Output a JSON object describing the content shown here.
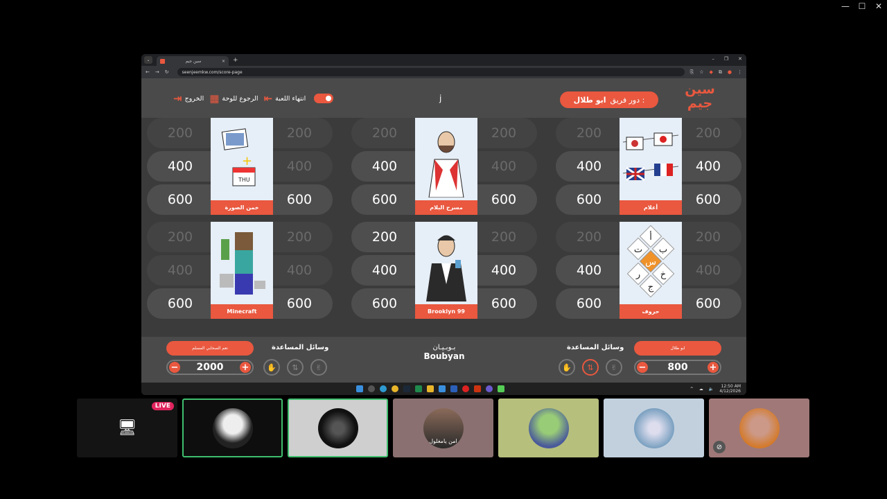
{
  "window_controls": {
    "minimize": "—",
    "maximize": "☐",
    "close": "✕"
  },
  "browser": {
    "tab_title": "سين جيم",
    "tab_close": "×",
    "new_tab": "+",
    "url": "seenjeemkw.com/score-page",
    "controls": {
      "minimize": "–",
      "restore": "❐",
      "close": "✕"
    }
  },
  "header": {
    "logo": "سين جيم",
    "turn_label": "دور فريق :",
    "turn_team": "ابو طلال",
    "center_letter": "j",
    "end_game_label": "انتهاء اللعبة",
    "back_to_board_label": "الرجوع للوحة",
    "exit_label": "الخروج"
  },
  "categories": [
    {
      "name": "خمن الصورة",
      "left": [
        {
          "v": "200",
          "used": true
        },
        {
          "v": "400",
          "used": false
        },
        {
          "v": "600",
          "used": false
        }
      ],
      "right": [
        {
          "v": "200",
          "used": true
        },
        {
          "v": "400",
          "used": true
        },
        {
          "v": "600",
          "used": false
        }
      ]
    },
    {
      "name": "مسرح البلام",
      "left": [
        {
          "v": "200",
          "used": true
        },
        {
          "v": "400",
          "used": false
        },
        {
          "v": "600",
          "used": false
        }
      ],
      "right": [
        {
          "v": "200",
          "used": true
        },
        {
          "v": "400",
          "used": true
        },
        {
          "v": "600",
          "used": false
        }
      ]
    },
    {
      "name": "أعلام",
      "left": [
        {
          "v": "200",
          "used": true
        },
        {
          "v": "400",
          "used": false
        },
        {
          "v": "600",
          "used": false
        }
      ],
      "right": [
        {
          "v": "200",
          "used": true
        },
        {
          "v": "400",
          "used": false
        },
        {
          "v": "600",
          "used": false
        }
      ]
    },
    {
      "name": "Minecraft",
      "left": [
        {
          "v": "200",
          "used": true
        },
        {
          "v": "400",
          "used": true
        },
        {
          "v": "600",
          "used": false
        }
      ],
      "right": [
        {
          "v": "200",
          "used": true
        },
        {
          "v": "400",
          "used": true
        },
        {
          "v": "600",
          "used": false
        }
      ]
    },
    {
      "name": "Brooklyn 99",
      "left": [
        {
          "v": "200",
          "used": false
        },
        {
          "v": "400",
          "used": false
        },
        {
          "v": "600",
          "used": false
        }
      ],
      "right": [
        {
          "v": "200",
          "used": true
        },
        {
          "v": "400",
          "used": false
        },
        {
          "v": "600",
          "used": false
        }
      ]
    },
    {
      "name": "حروف",
      "left": [
        {
          "v": "200",
          "used": true
        },
        {
          "v": "400",
          "used": false
        },
        {
          "v": "600",
          "used": false
        }
      ],
      "right": [
        {
          "v": "200",
          "used": true
        },
        {
          "v": "400",
          "used": true
        },
        {
          "v": "600",
          "used": false
        }
      ]
    }
  ],
  "team_left": {
    "name": "نعم الصحابي المسلم",
    "score": "2000",
    "help_title": "وسائل المساعدة"
  },
  "team_right": {
    "name": "ابو طلال",
    "score": "800",
    "help_title": "وسائل المساعدة"
  },
  "sponsor": {
    "arabic": "بـوبـيـان",
    "english": "Boubyan"
  },
  "taskbar": {
    "time": "12:50 AM",
    "date": "4/12/2026"
  },
  "participants": [
    {
      "label": "",
      "live": "LIVE"
    },
    {
      "label": ""
    },
    {
      "label": ""
    },
    {
      "label": "امن يامغلول"
    },
    {
      "label": ""
    },
    {
      "label": ""
    },
    {
      "label": ""
    }
  ],
  "colors": {
    "accent": "#e9583f",
    "board": "#3b3b3b",
    "header": "#4a4a4a"
  }
}
